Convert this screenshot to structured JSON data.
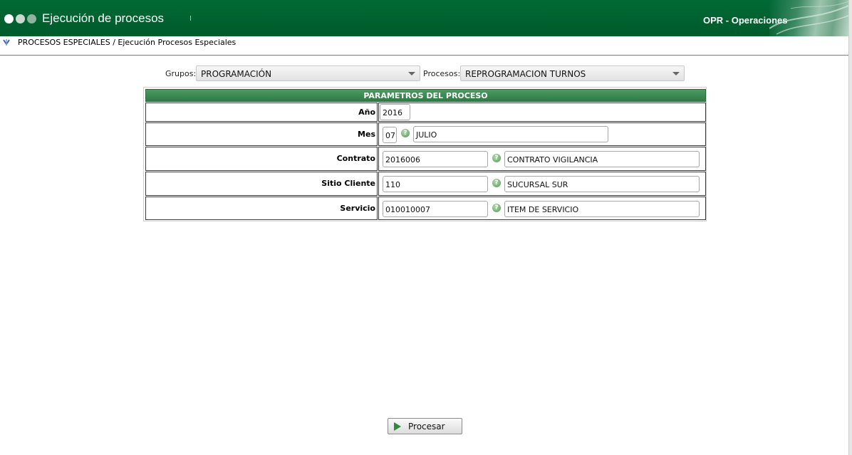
{
  "header": {
    "title": "Ejecución de procesos",
    "module": "OPR - Operaciones"
  },
  "breadcrumb": {
    "icon": "down-arrow-icon",
    "text": "PROCESOS ESPECIALES / Ejecución Procesos Especiales"
  },
  "filters": {
    "groups_label": "Grupos:",
    "groups_value": "PROGRAMACIÓN",
    "processes_label": "Procesos:",
    "processes_value": "REPROGRAMACION TURNOS"
  },
  "params": {
    "title": "PARAMETROS DEL PROCESO",
    "year": {
      "label": "Año",
      "value": "2016"
    },
    "month": {
      "label": "Mes",
      "code": "07",
      "name": "JULIO"
    },
    "contract": {
      "label": "Contrato",
      "code": "2016006",
      "name": "CONTRATO VIGILANCIA"
    },
    "site": {
      "label": "Sitio Cliente",
      "code": "110",
      "name": "SUCURSAL SUR"
    },
    "service": {
      "label": "Servicio",
      "code": "010010007",
      "name": "ITEM DE SERVICIO"
    }
  },
  "actions": {
    "process_label": "Procesar"
  },
  "colors": {
    "header_green": "#006a35",
    "title_bar_green": "#3d8a55",
    "play_green": "#2e8b3e"
  }
}
